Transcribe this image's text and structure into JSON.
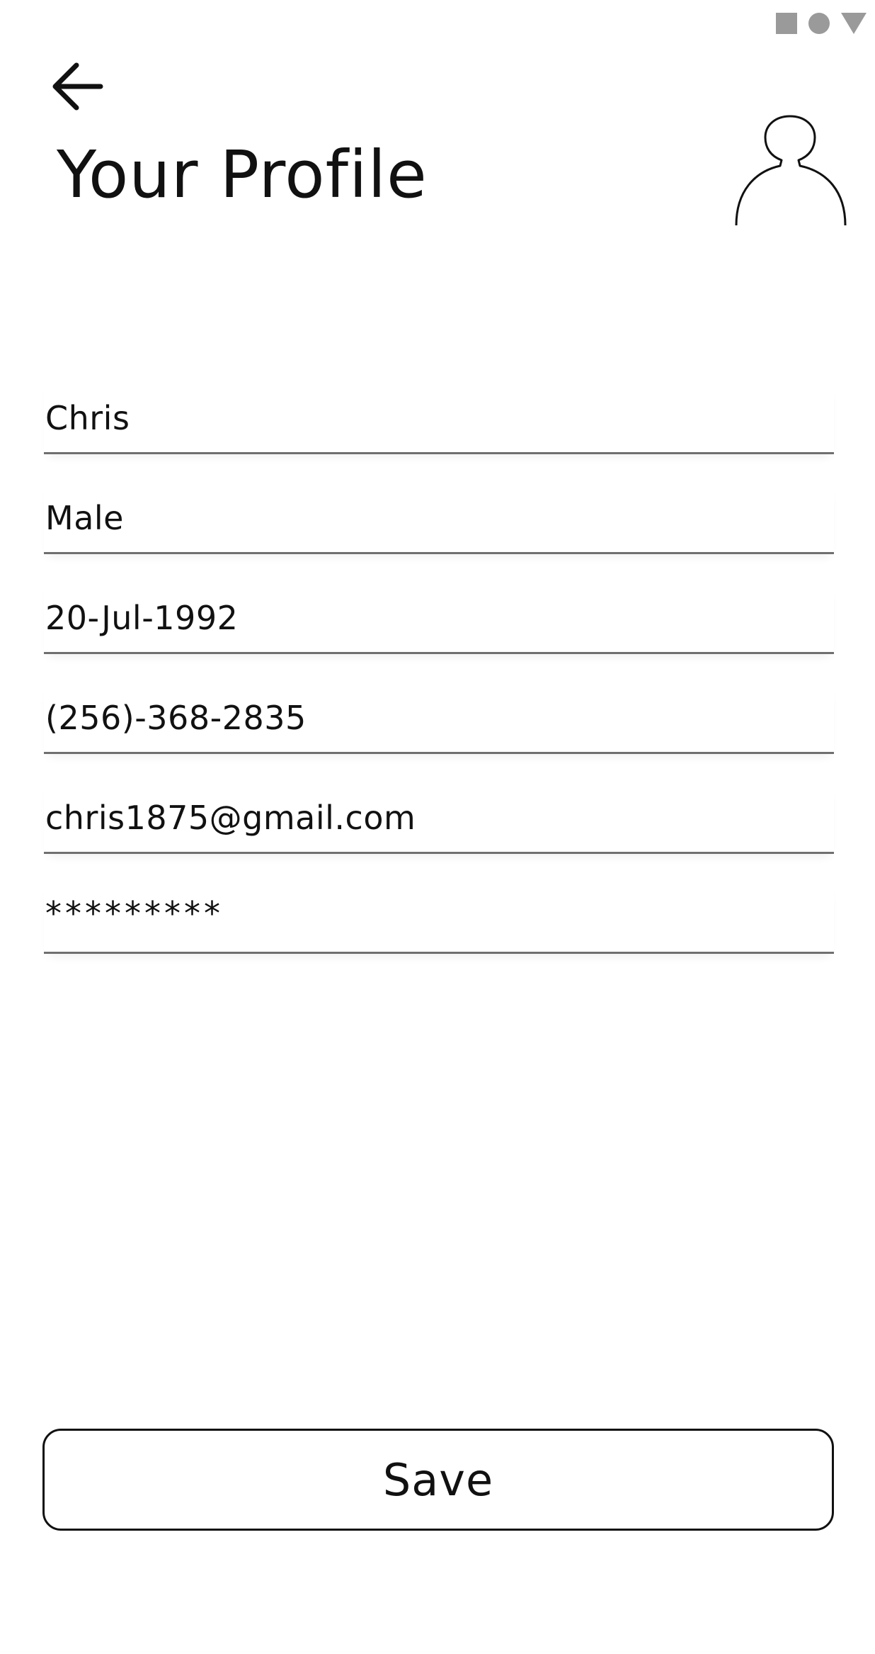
{
  "header": {
    "title": "Your Profile",
    "back_icon": "arrow-left-icon",
    "avatar_icon": "user-avatar-icon"
  },
  "status_bar": {
    "icons": [
      "square-icon",
      "circle-icon",
      "triangle-down-icon"
    ],
    "color": "#9a9a9a"
  },
  "form": {
    "fields": [
      {
        "name": "name",
        "value": "Chris"
      },
      {
        "name": "gender",
        "value": "Male"
      },
      {
        "name": "birthdate",
        "value": "20-Jul-1992"
      },
      {
        "name": "phone",
        "value": "(256)-368-2835"
      },
      {
        "name": "email",
        "value": "chris1875@gmail.com"
      },
      {
        "name": "password",
        "value": "*********"
      }
    ]
  },
  "actions": {
    "save_label": "Save"
  },
  "colors": {
    "text": "#111111",
    "underline": "#6f6f6f",
    "background": "#ffffff"
  }
}
